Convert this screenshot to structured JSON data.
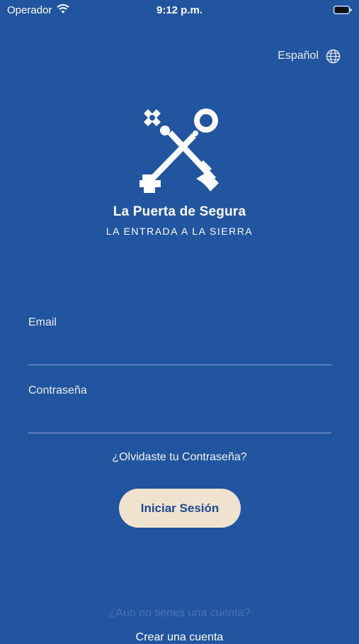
{
  "status_bar": {
    "carrier": "Operador",
    "time": "9:12 p.m."
  },
  "language": {
    "label": "Español",
    "icon": "globe-icon"
  },
  "brand": {
    "title": "La Puerta de Segura",
    "subtitle": "LA ENTRADA A LA SIERRA",
    "logo": "crossed-keys-logo"
  },
  "form": {
    "email_label": "Email",
    "email_value": "",
    "password_label": "Contraseña",
    "password_value": "",
    "forgot_password": "¿Olvidaste tu Contraseña?",
    "login_button": "Iniciar Sesión"
  },
  "footer": {
    "no_account": "¿Aun no tienes una cuenta?",
    "create_account": "Crear una cuenta"
  },
  "colors": {
    "background": "#2255a0",
    "button_bg": "#efe2cf",
    "button_text": "#1f4a93"
  }
}
